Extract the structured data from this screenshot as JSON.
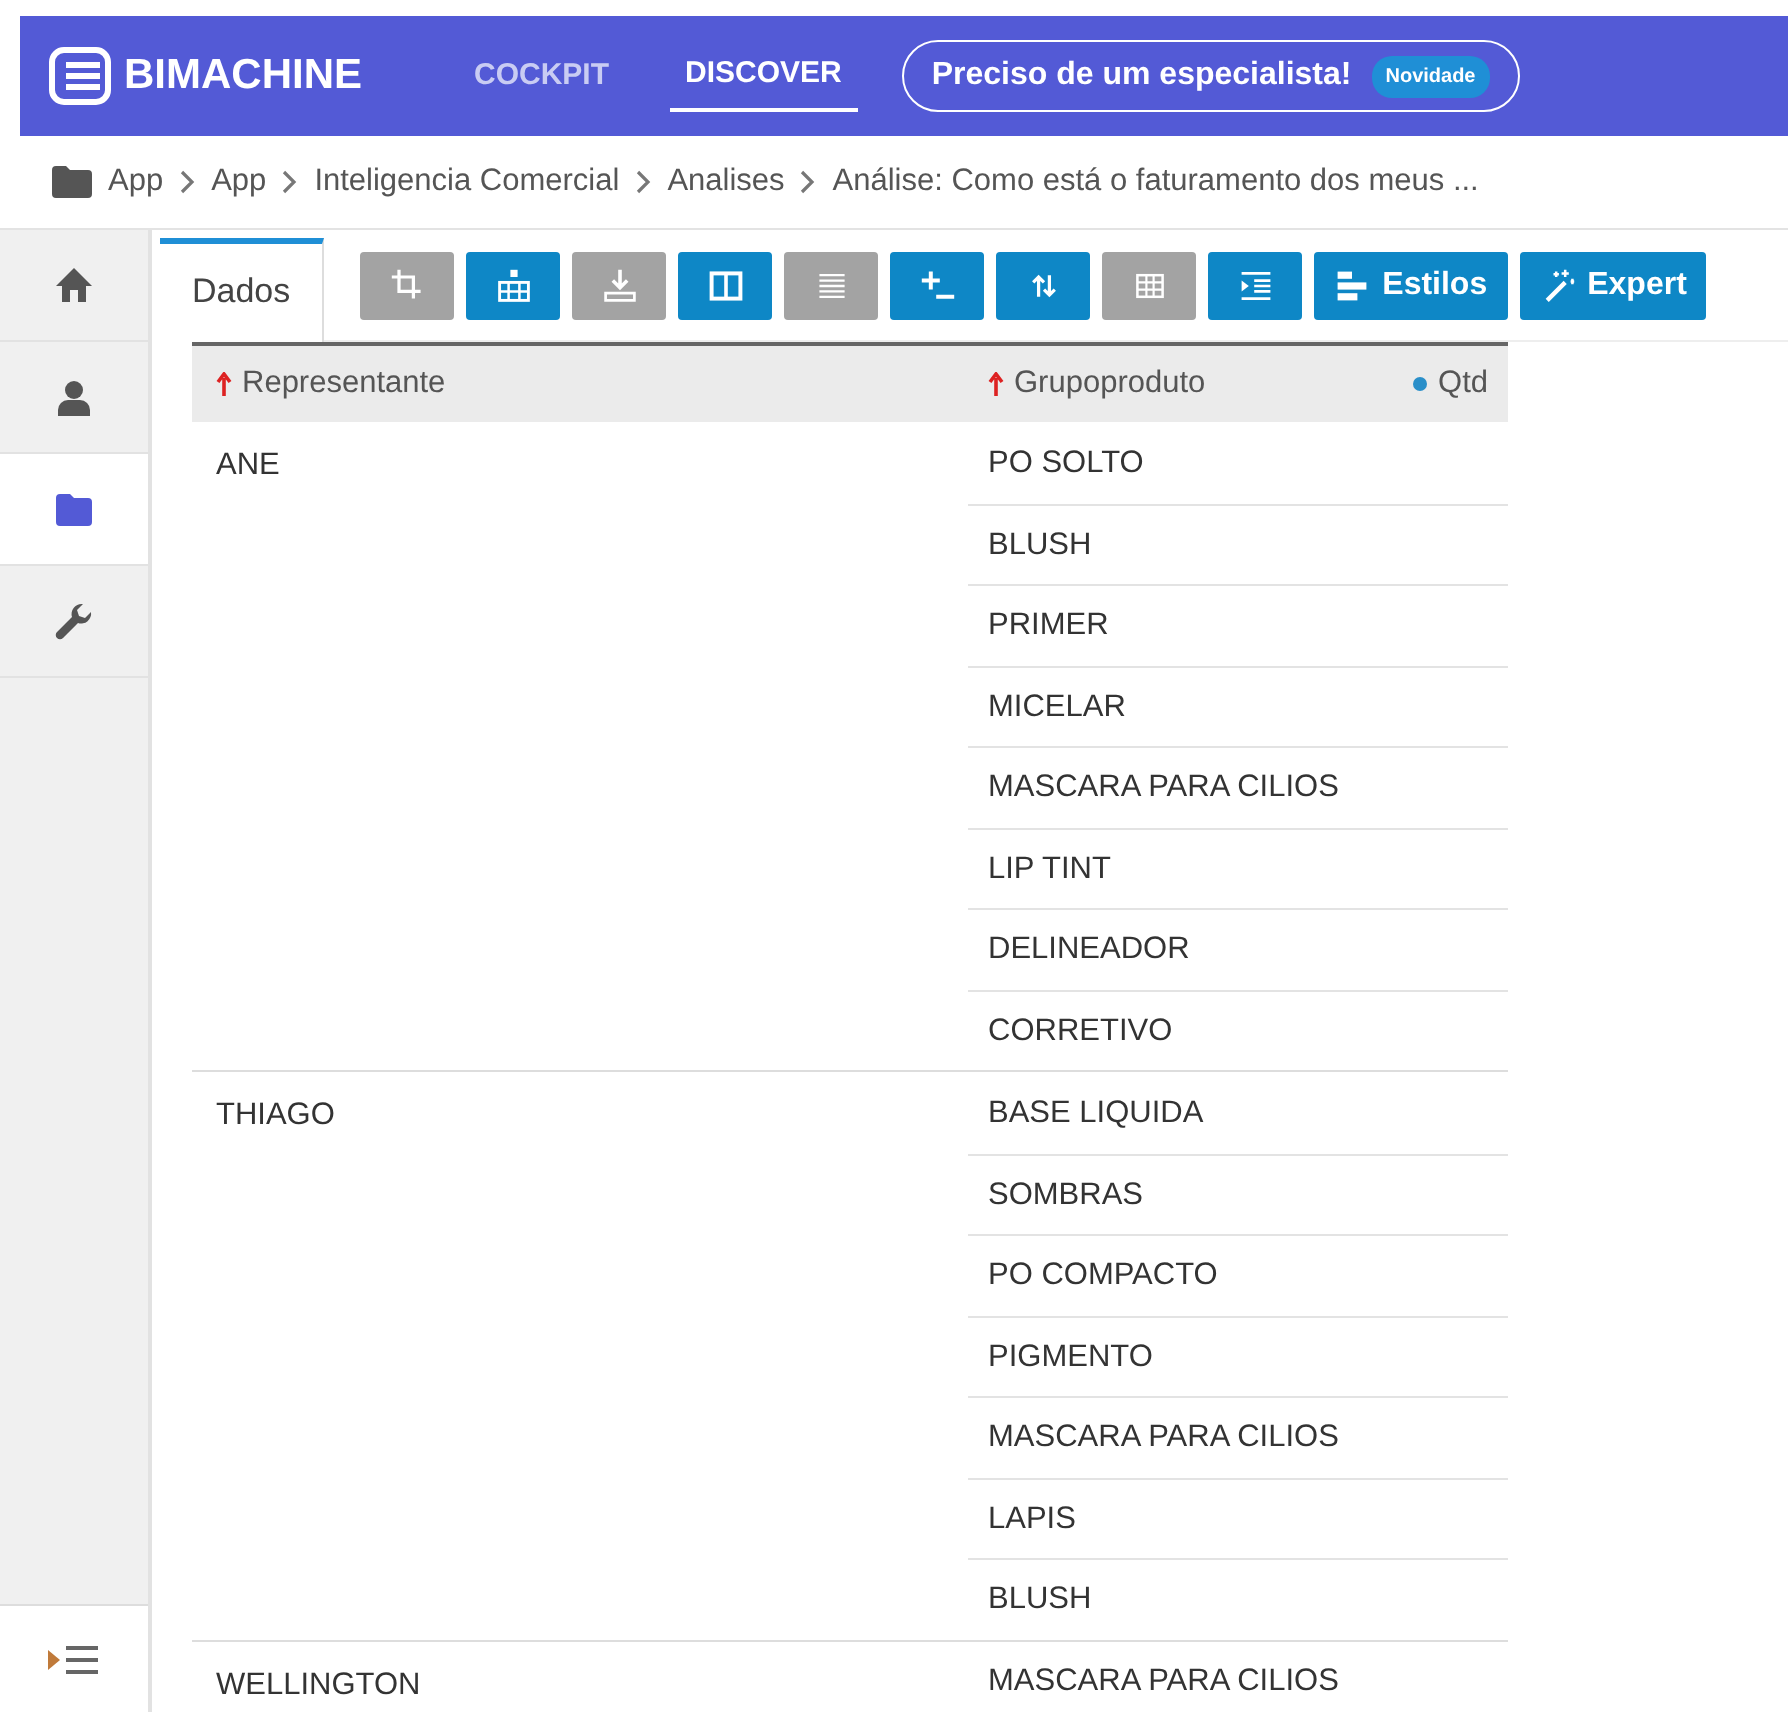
{
  "header": {
    "logo": "BIMACHINE",
    "nav": [
      {
        "label": "COCKPIT",
        "selected": false
      },
      {
        "label": "DISCOVER",
        "selected": true
      }
    ],
    "promo": {
      "label": "Preciso de um especialista!",
      "badge": "Novidade"
    }
  },
  "breadcrumb": [
    "App",
    "App",
    "Inteligencia Comercial",
    "Analises",
    "Análise: Como está o faturamento dos meus ..."
  ],
  "sidebar": {
    "items": [
      {
        "kind": "home",
        "selected": false
      },
      {
        "kind": "user",
        "selected": false
      },
      {
        "kind": "folder",
        "selected": true
      },
      {
        "kind": "wrench",
        "selected": false
      }
    ]
  },
  "tab": {
    "label": "Dados",
    "selected": true
  },
  "toolbar": [
    {
      "kind": "crop",
      "active": false
    },
    {
      "kind": "hierarchy",
      "active": true
    },
    {
      "kind": "download",
      "active": false
    },
    {
      "kind": "columns",
      "active": true
    },
    {
      "kind": "lines",
      "active": false
    },
    {
      "kind": "plusminus",
      "active": true
    },
    {
      "kind": "sort",
      "active": true
    },
    {
      "kind": "grid",
      "active": false
    },
    {
      "kind": "indent",
      "active": true
    },
    {
      "kind": "styles",
      "active": true,
      "label": "Estilos"
    },
    {
      "kind": "wand",
      "active": true,
      "label": "Expert"
    }
  ],
  "table": {
    "columns": [
      {
        "label": "Representante",
        "kind": "sorted"
      },
      {
        "label": "Grupoproduto",
        "kind": "sorted"
      },
      {
        "label": "Qtd",
        "kind": "measure"
      }
    ],
    "groups": [
      {
        "name": "ANE",
        "items": [
          "PO SOLTO",
          "BLUSH",
          "PRIMER",
          "MICELAR",
          "MASCARA PARA CILIOS",
          "LIP TINT",
          "DELINEADOR",
          "CORRETIVO"
        ]
      },
      {
        "name": "THIAGO",
        "items": [
          "BASE LIQUIDA",
          "SOMBRAS",
          "PO COMPACTO",
          "PIGMENTO",
          "MASCARA PARA CILIOS",
          "LAPIS",
          "BLUSH"
        ]
      },
      {
        "name": "WELLINGTON",
        "items": [
          "MASCARA PARA CILIOS"
        ]
      }
    ]
  }
}
